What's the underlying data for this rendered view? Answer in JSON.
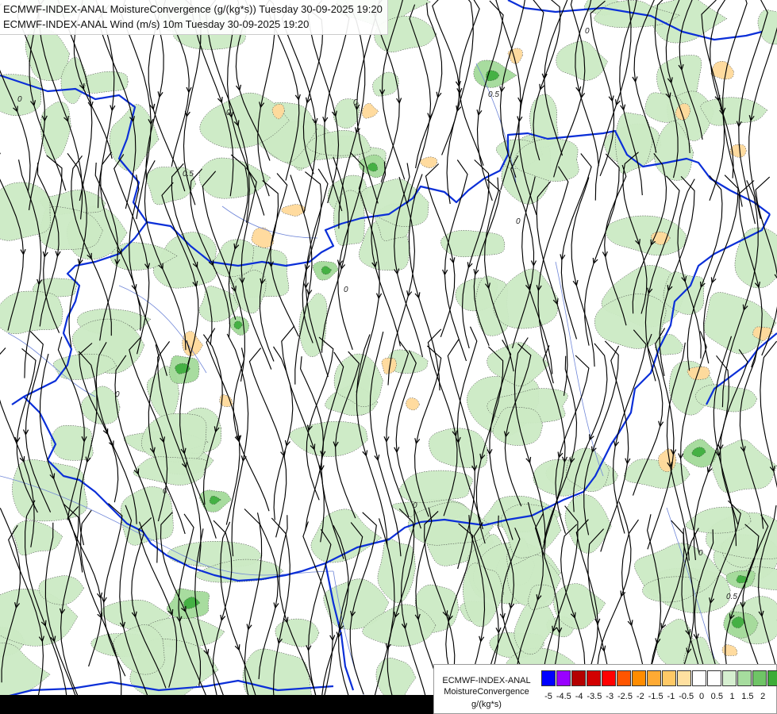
{
  "header": {
    "line1": "ECMWF-INDEX-ANAL MoistureConvergence (g/(kg*s)) Tuesday 30-09-2025 19:20",
    "line2": "ECMWF-INDEX-ANAL Wind (m/s) 10m Tuesday 30-09-2025 19:20"
  },
  "legend": {
    "title1": "ECMWF-INDEX-ANAL",
    "title2": "MoistureConvergence",
    "units": "g/(kg*s)",
    "colors": [
      "#0000ff",
      "#9900ff",
      "#b40000",
      "#d20000",
      "#ff0000",
      "#ff5500",
      "#ff8c00",
      "#ffaa33",
      "#ffc966",
      "#ffe0a0",
      "#ffffff",
      "#ffffff",
      "#d6efd0",
      "#a6dc9e",
      "#6fc466",
      "#3cac37",
      "#0fa00f"
    ],
    "ticks": [
      "-5",
      "-4.5",
      "-4",
      "-3.5",
      "-3",
      "-2.5",
      "-2",
      "-1.5",
      "-1",
      "-0.5",
      "0",
      "0.5",
      "1",
      "1.5",
      "2"
    ]
  },
  "map": {
    "colors": {
      "green_light": "#cbeac4",
      "green_mid": "#a3da9a",
      "green_dark": "#3fae3f",
      "orange_light": "#ffd99a",
      "border": "#0b2fd8",
      "river": "#6f86d8",
      "streamline": "#000000"
    },
    "contour_labels": [
      "0",
      "0",
      "0",
      "0.5",
      "0.5",
      "0",
      "0",
      "0",
      "0",
      "0",
      "0.5",
      "0",
      "0"
    ]
  }
}
